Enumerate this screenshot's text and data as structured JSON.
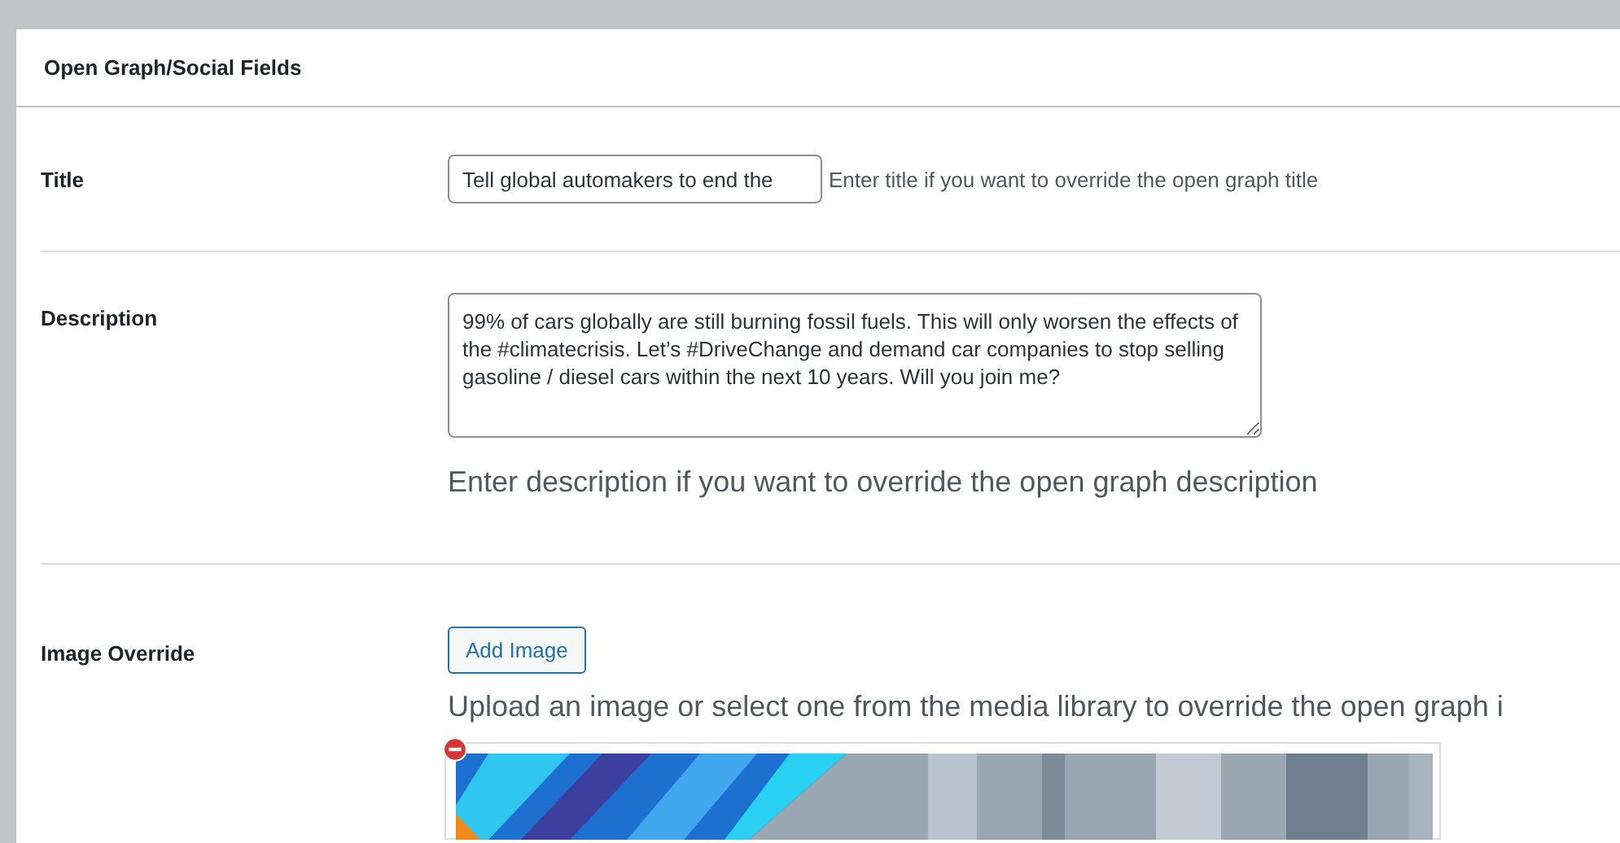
{
  "panel": {
    "title": "Open Graph/Social Fields"
  },
  "rows": [
    {
      "kind": "text",
      "label": "Title",
      "value": "Tell global automakers to end the",
      "hint": "Enter title if you want to override the open graph title"
    },
    {
      "kind": "textarea",
      "label": "Description",
      "value": "99% of cars globally are still burning fossil fuels. This will only worsen the effects of the #climatecrisis. Let’s #DriveChange and demand car companies to stop selling gasoline / diesel cars within the next 10 years. Will you join me?",
      "hint": "Enter description if you want to override the open graph description"
    },
    {
      "label": "Image Override",
      "button": "Add Image",
      "hint": "Upload an image or select one from the media library to override the open graph i"
    }
  ]
}
